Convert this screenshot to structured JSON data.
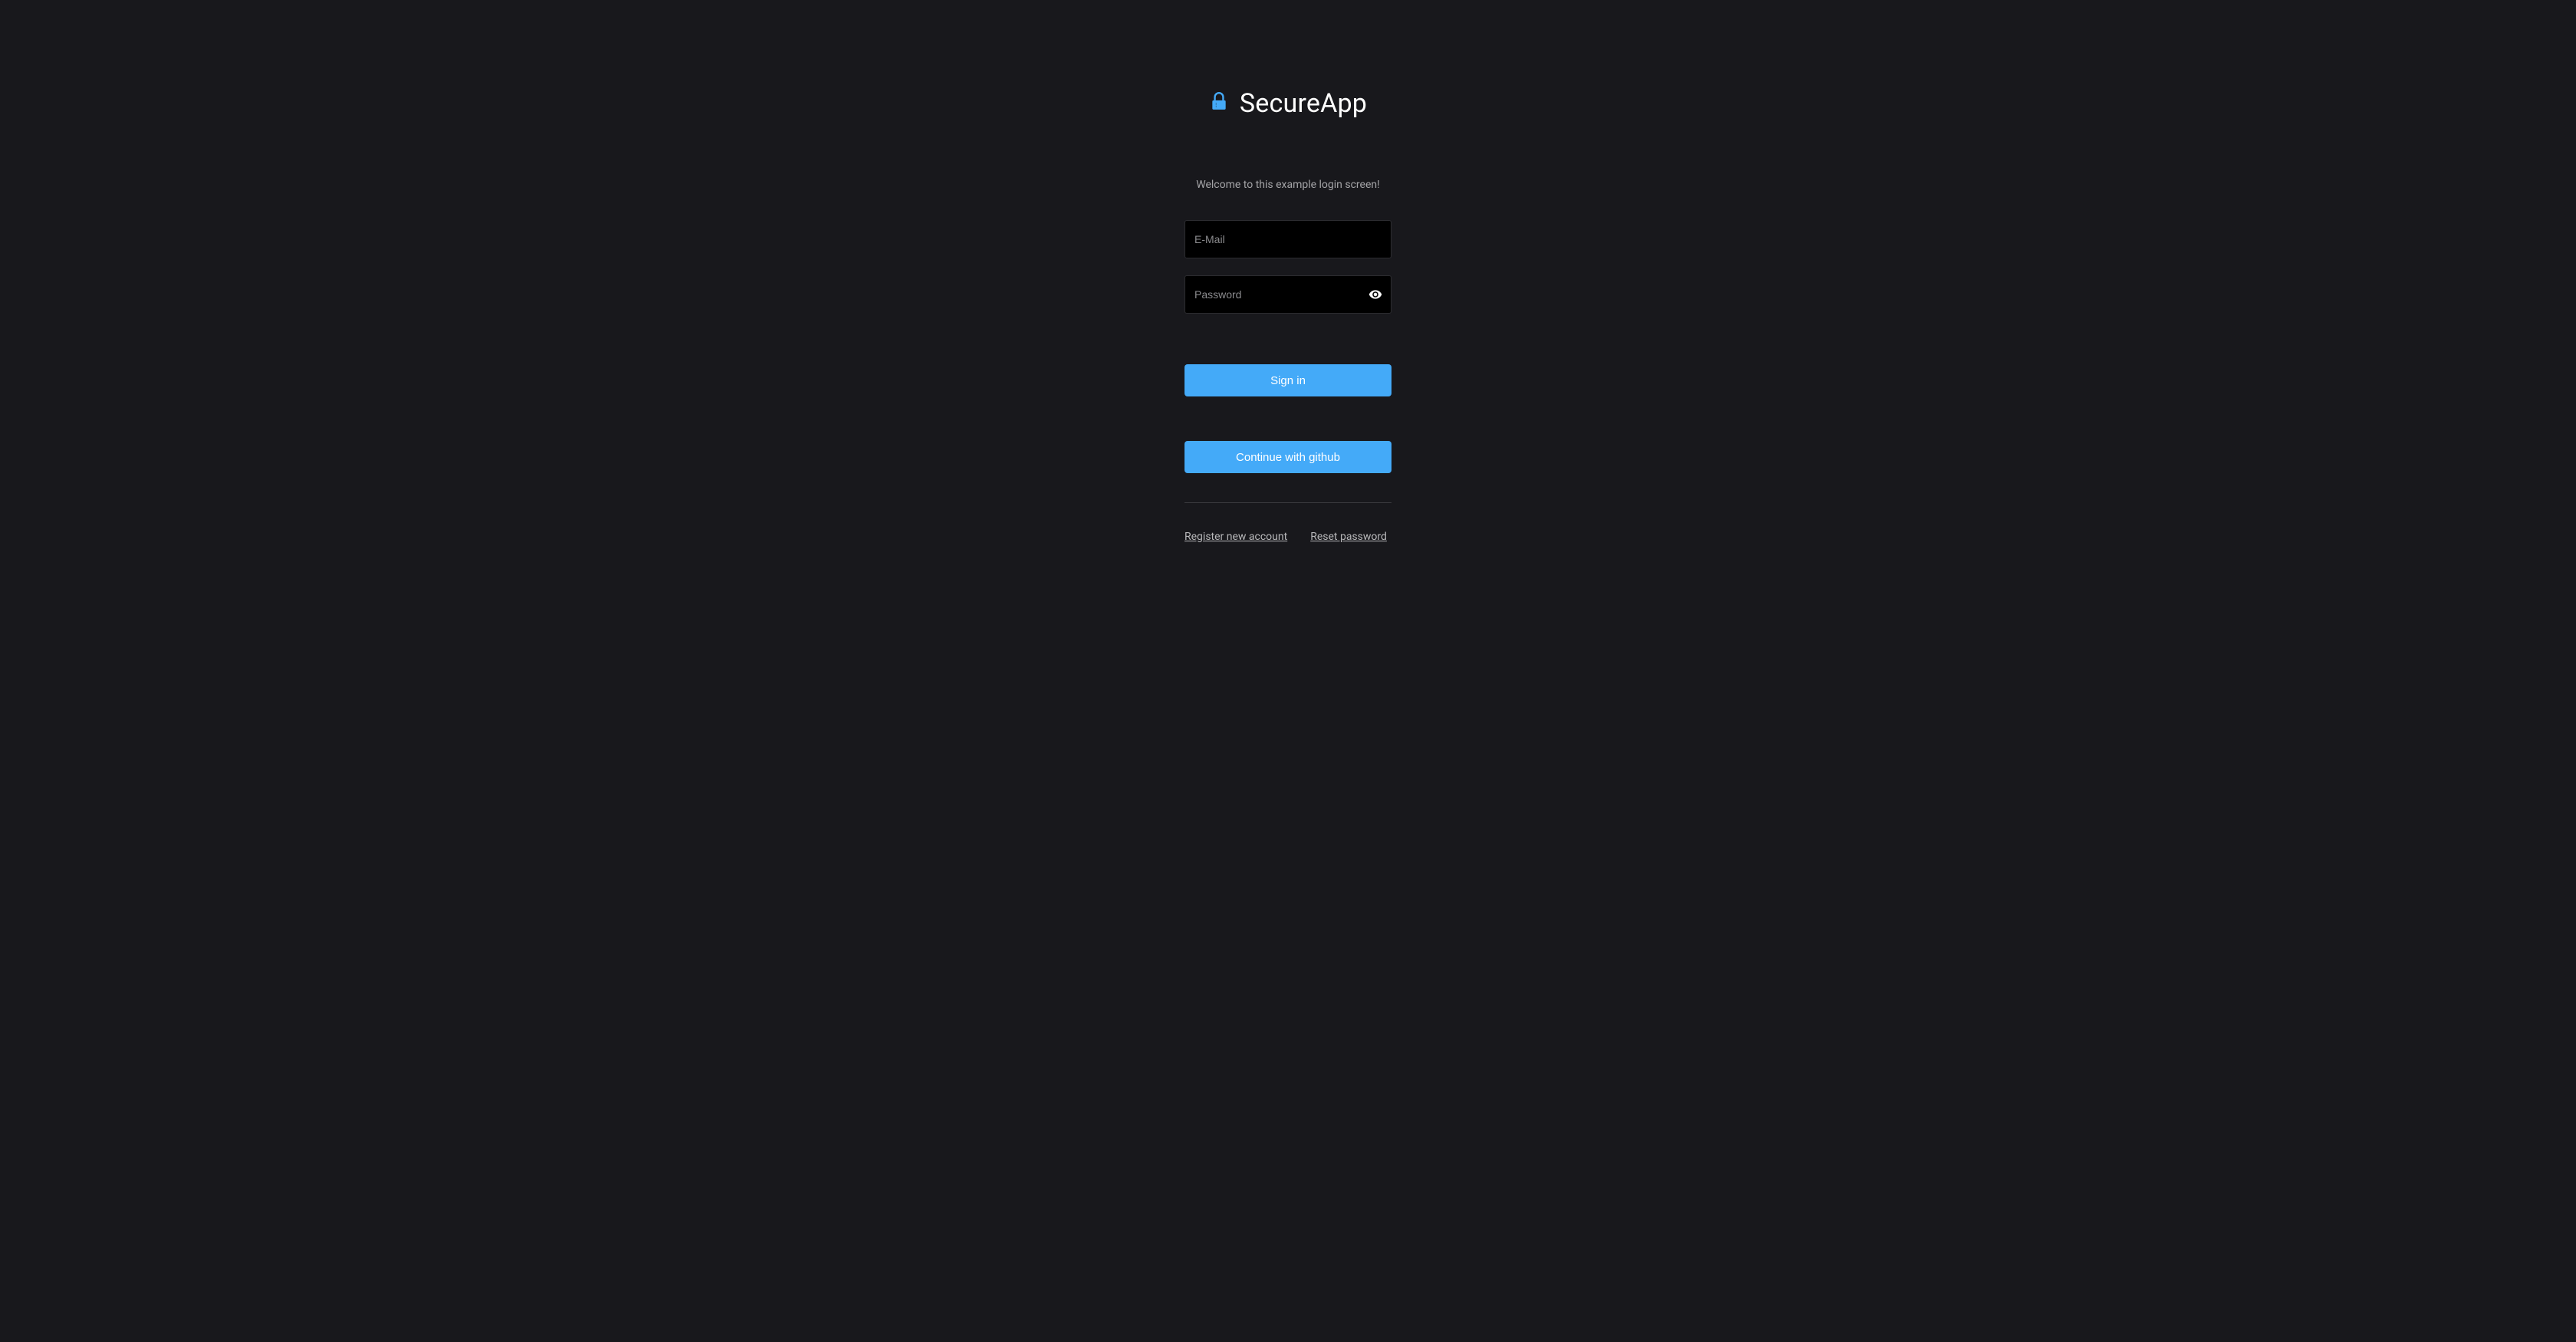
{
  "header": {
    "title": "SecureApp"
  },
  "welcome_message": "Welcome to this example login screen!",
  "inputs": {
    "email": {
      "placeholder": "E-Mail",
      "value": ""
    },
    "password": {
      "placeholder": "Password",
      "value": ""
    }
  },
  "buttons": {
    "signin": "Sign in",
    "github": "Continue with github"
  },
  "links": {
    "register": "Register new account",
    "reset": "Reset password"
  }
}
